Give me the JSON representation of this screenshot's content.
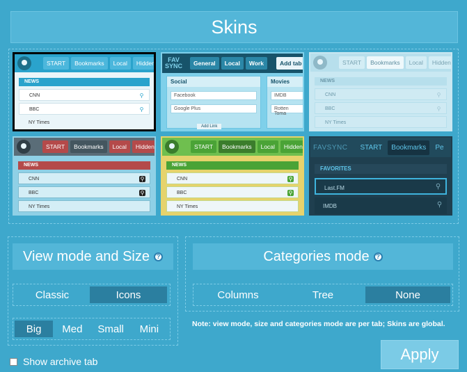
{
  "title": "Skins",
  "skins": {
    "s1": {
      "tabs": [
        "START",
        "Bookmarks",
        "Local",
        "Hidden"
      ],
      "category": "NEWS",
      "rows": [
        "CNN",
        "BBC",
        "NY Times"
      ]
    },
    "s2": {
      "brand": "FAV SYNC",
      "tabs": [
        "General",
        "Local",
        "Work"
      ],
      "add_tab": "Add tab",
      "columns": [
        {
          "title": "Social",
          "rows": [
            "Facebook",
            "Google Plus"
          ]
        },
        {
          "title": "Movies",
          "rows": [
            "IMDB",
            "Rotten Toma"
          ]
        }
      ],
      "add_link": "Add Link"
    },
    "s3": {
      "tabs": [
        "START",
        "Bookmarks",
        "Local",
        "Hidden"
      ],
      "category": "NEWS",
      "rows": [
        "CNN",
        "BBC",
        "NY Times"
      ]
    },
    "s4": {
      "tabs": [
        "START",
        "Bookmarks",
        "Local",
        "Hidden"
      ],
      "category": "NEWS",
      "rows": [
        "CNN",
        "BBC",
        "NY Times"
      ]
    },
    "s5": {
      "tabs": [
        "START",
        "Bookmarks",
        "Local",
        "Hidden"
      ],
      "category": "NEWS",
      "rows": [
        "CNN",
        "BBC",
        "NY Times"
      ]
    },
    "s6": {
      "brand": "FAVSYNC",
      "tabs": [
        "START",
        "Bookmarks",
        "Pe"
      ],
      "category": "FAVORITES",
      "rows": [
        "Last.FM",
        "IMDB"
      ]
    }
  },
  "view": {
    "title": "View mode and Size",
    "modes": [
      "Classic",
      "Icons"
    ],
    "sizes": [
      "Big",
      "Med",
      "Small",
      "Mini"
    ]
  },
  "categories": {
    "title": "Categories mode",
    "modes": [
      "Columns",
      "Tree",
      "None"
    ]
  },
  "note": "Note: view mode, size and categories mode are per tab; Skins are global.",
  "archive_label": "Show archive tab",
  "apply_label": "Apply"
}
